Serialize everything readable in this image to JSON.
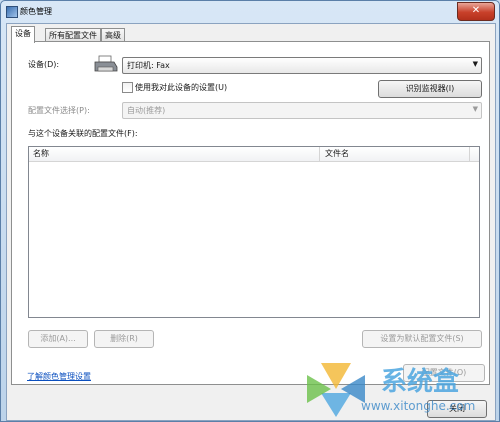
{
  "window": {
    "title": "颜色管理",
    "close_glyph": "✕"
  },
  "tabs": [
    {
      "label": "设备"
    },
    {
      "label": "所有配置文件"
    },
    {
      "label": "高级"
    }
  ],
  "device": {
    "label": "设备(D):",
    "value": "打印机: Fax",
    "use_settings_label": "使用我对此设备的设置(U)",
    "identify_button": "识别监视器(I)"
  },
  "profile_select": {
    "label": "配置文件选择(P):",
    "value": "自动(推荐)"
  },
  "assoc": {
    "label": "与这个设备关联的配置文件(F):",
    "columns": [
      "名称",
      "文件名"
    ]
  },
  "buttons": {
    "add": "添加(A)...",
    "remove": "删除(R)",
    "set_default": "设置为默认配置文件(S)",
    "profiles": "配置文件(O)",
    "close": "关闭"
  },
  "footer": {
    "learn_link": "了解颜色管理设置"
  },
  "watermark": {
    "text": "系统盒",
    "url": "www.xitonghe.com"
  },
  "colors": {
    "annotation": "#e0141e",
    "link": "#0a4fbf",
    "close_button": "#c8402a"
  }
}
